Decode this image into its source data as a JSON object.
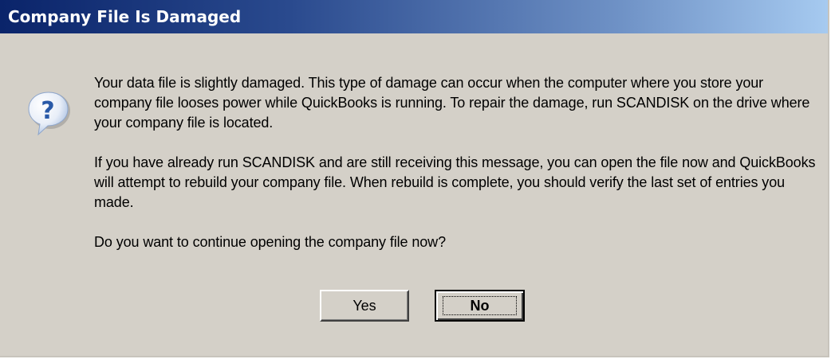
{
  "dialog": {
    "title": "Company File Is Damaged",
    "icon": "question-icon",
    "paragraphs": [
      "Your data file is slightly damaged.  This type of damage can occur when the computer where you store your company file looses power while QuickBooks is running.  To repair the damage, run SCANDISK on the drive where your company file is located.",
      "If you have already run SCANDISK and are still receiving this message, you can open the file now and QuickBooks will attempt to rebuild your company file.  When rebuild is complete, you should verify the last set of entries you made.",
      "Do you want to continue opening the company file now?"
    ],
    "buttons": {
      "yes": "Yes",
      "no": "No"
    },
    "colors": {
      "titlebar_start": "#0a246a",
      "titlebar_end": "#a6caf0",
      "face": "#d4d0c8",
      "icon_blue": "#2a5aa8"
    }
  }
}
